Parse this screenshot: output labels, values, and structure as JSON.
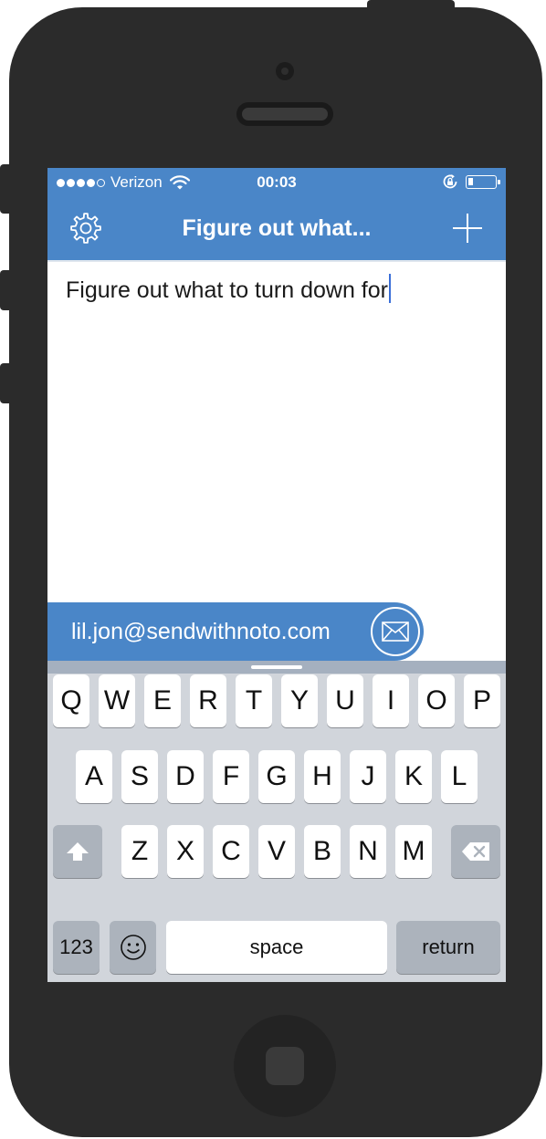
{
  "status_bar": {
    "carrier": "Verizon",
    "signal_dots_filled": 4,
    "signal_dots_total": 5,
    "time": "00:03",
    "battery_level": 0.2,
    "icons": [
      "wifi-icon",
      "rotation-lock-icon",
      "battery-icon"
    ]
  },
  "navbar": {
    "title": "Figure out what...",
    "left_icon": "gear-icon",
    "right_icon": "plus-icon"
  },
  "editor": {
    "text": "Figure out what to turn down for"
  },
  "email_bar": {
    "email": "lil.jon@sendwithnoto.com",
    "send_icon": "envelope-icon"
  },
  "keyboard": {
    "row1": [
      "Q",
      "W",
      "E",
      "R",
      "T",
      "Y",
      "U",
      "I",
      "O",
      "P"
    ],
    "row2": [
      "A",
      "S",
      "D",
      "F",
      "G",
      "H",
      "J",
      "K",
      "L"
    ],
    "row3": [
      "Z",
      "X",
      "C",
      "V",
      "B",
      "N",
      "M"
    ],
    "numbers_label": "123",
    "space_label": "space",
    "return_label": "return",
    "shift_icon": "shift-icon",
    "delete_icon": "backspace-icon",
    "emoji_icon": "emoji-icon"
  },
  "colors": {
    "accent": "#4a86c8",
    "caret": "#3a6fd8",
    "keyboard_bg": "#d1d5db"
  }
}
